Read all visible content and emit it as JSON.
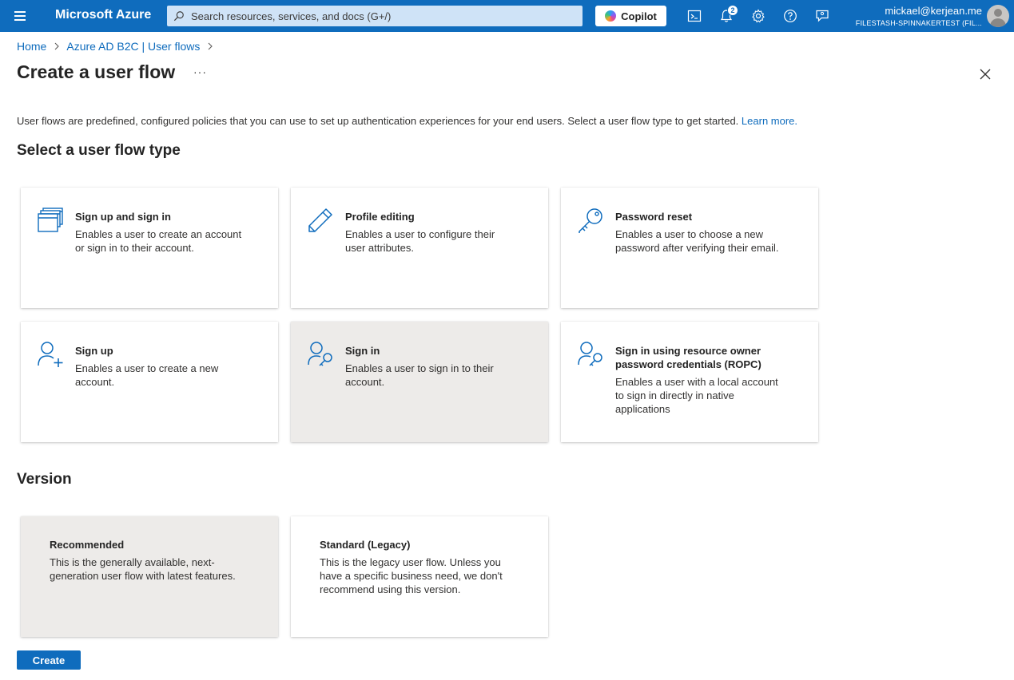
{
  "header": {
    "brand": "Microsoft Azure",
    "search_placeholder": "Search resources, services, and docs (G+/)",
    "copilot_label": "Copilot",
    "notification_count": "2",
    "user_email": "mickael@kerjean.me",
    "user_tenant": "FILESTASH-SPINNAKERTEST (FIL...",
    "accent_color": "#0f6cbd"
  },
  "breadcrumb": {
    "items": [
      "Home",
      "Azure AD B2C | User flows"
    ]
  },
  "page": {
    "title": "Create a user flow",
    "more_label": "···",
    "intro_text": "User flows are predefined, configured policies that you can use to set up authentication experiences for your end users. Select a user flow type to get started.",
    "learn_more": "Learn more."
  },
  "flow_types": {
    "section_title": "Select a user flow type",
    "selected": "Sign in",
    "items": [
      {
        "icon": "windows-stack-icon",
        "title": "Sign up and sign in",
        "description": "Enables a user to create an account or sign in to their account."
      },
      {
        "icon": "pencil-icon",
        "title": "Profile editing",
        "description": "Enables a user to configure their user attributes."
      },
      {
        "icon": "key-icon",
        "title": "Password reset",
        "description": "Enables a user to choose a new password after verifying their email."
      },
      {
        "icon": "person-add-icon",
        "title": "Sign up",
        "description": "Enables a user to create a new account."
      },
      {
        "icon": "person-key-icon",
        "title": "Sign in",
        "description": "Enables a user to sign in to their account."
      },
      {
        "icon": "person-key-icon",
        "title": "Sign in using resource owner password credentials (ROPC)",
        "description": "Enables a user with a local account to sign in directly in native applications"
      }
    ]
  },
  "version": {
    "section_title": "Version",
    "selected": "Recommended",
    "items": [
      {
        "title": "Recommended",
        "description": "This is the generally available, next-generation user flow with latest features."
      },
      {
        "title": "Standard (Legacy)",
        "description": "This is the legacy user flow. Unless you have a specific business need, we don't recommend using this version."
      }
    ]
  },
  "actions": {
    "create_label": "Create"
  }
}
